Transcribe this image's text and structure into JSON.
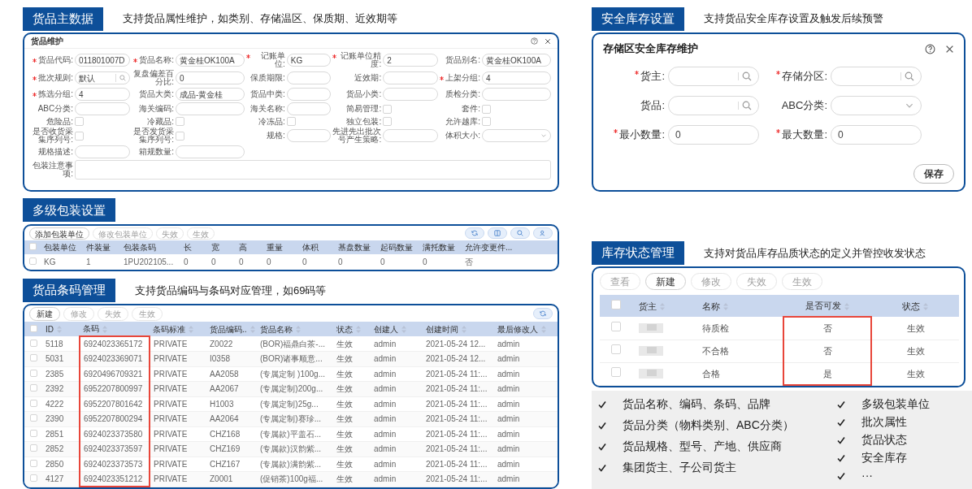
{
  "product_master": {
    "title": "货品主数据",
    "description": "支持货品属性维护，如类别、存储温区、保质期、近效期等",
    "form": {
      "title": "货品维护",
      "fields": [
        {
          "label": "货品代码:",
          "required": true,
          "kind": "text",
          "value": "011801007D"
        },
        {
          "label": "货品名称:",
          "required": true,
          "kind": "text",
          "value": "黄金桂OK100A"
        },
        {
          "label": "记账单位:",
          "required": true,
          "kind": "text",
          "value": "KG"
        },
        {
          "label": "记账单位精度:",
          "required": true,
          "kind": "text",
          "value": "2"
        },
        {
          "label": "货品别名:",
          "required": false,
          "kind": "text",
          "value": "黄金桂OK100A"
        },
        {
          "label": "批次规则:",
          "required": true,
          "kind": "search",
          "value": "默认"
        },
        {
          "label": "复盘偏差百分比:",
          "required": false,
          "kind": "text",
          "value": "0"
        },
        {
          "label": "保质期限:",
          "required": false,
          "kind": "text"
        },
        {
          "label": "近效期:",
          "required": false,
          "kind": "text"
        },
        {
          "label": "上架分组:",
          "required": true,
          "kind": "text",
          "value": "4"
        },
        {
          "label": "拣选分组:",
          "required": true,
          "kind": "text",
          "value": "4"
        },
        {
          "label": "货品大类:",
          "required": false,
          "kind": "text",
          "value": "成品-黄金桂"
        },
        {
          "label": "货品中类:",
          "required": false,
          "kind": "text"
        },
        {
          "label": "货品小类:",
          "required": false,
          "kind": "text"
        },
        {
          "label": "质检分类:",
          "required": false,
          "kind": "text"
        },
        {
          "label": "ABC分类:",
          "required": false,
          "kind": "text"
        },
        {
          "label": "海关编码:",
          "required": false,
          "kind": "text"
        },
        {
          "label": "海关名称:",
          "required": false,
          "kind": "text"
        },
        {
          "label": "简易管理:",
          "required": false,
          "kind": "checkbox",
          "checked": false
        },
        {
          "label": "套件:",
          "required": false,
          "kind": "checkbox",
          "checked": false
        },
        {
          "label": "危险品:",
          "required": false,
          "kind": "checkbox",
          "checked": false
        },
        {
          "label": "冷藏品:",
          "required": false,
          "kind": "checkbox",
          "checked": false
        },
        {
          "label": "冷冻品:",
          "required": false,
          "kind": "checkbox",
          "checked": false
        },
        {
          "label": "独立包装:",
          "required": false,
          "kind": "checkbox",
          "checked": false
        },
        {
          "label": "允许越库:",
          "required": false,
          "kind": "checkbox",
          "checked": false
        },
        {
          "label": "是否收货采集序列号:",
          "required": false,
          "kind": "checkbox",
          "checked": false
        },
        {
          "label": "是否发货采集序列号:",
          "required": false,
          "kind": "checkbox",
          "checked": false
        },
        {
          "label": "规格:",
          "required": false,
          "kind": "text"
        },
        {
          "label": "先进先出批次号产生策略:",
          "required": false,
          "kind": "text"
        },
        {
          "label": "体积大小:",
          "required": false,
          "kind": "select"
        },
        {
          "label": "规格描述:",
          "required": false,
          "kind": "text"
        },
        {
          "label": "箱规数量:",
          "required": false,
          "kind": "text"
        },
        {
          "label": "包装注意事项:",
          "required": false,
          "kind": "textarea"
        }
      ]
    }
  },
  "packaging": {
    "title": "多级包装设置",
    "buttons": [
      {
        "label": "添加包装单位",
        "disabled": false
      },
      {
        "label": "修改包装单位",
        "disabled": true
      },
      {
        "label": "失效",
        "disabled": true
      },
      {
        "label": "生效",
        "disabled": true
      }
    ],
    "table": {
      "all_checked": false,
      "columns": [
        "包装单位",
        "件装量",
        "包装条码",
        "长",
        "宽",
        "高",
        "重量",
        "体积",
        "基盘数量",
        "起码数量",
        "满托数量",
        "允许变更件..."
      ],
      "rows": [
        {
          "checked": false,
          "cells": [
            "KG",
            "1",
            "1PU202105...",
            "0",
            "0",
            "0",
            "0",
            "0",
            "0",
            "0",
            "0",
            "否"
          ]
        }
      ]
    }
  },
  "barcodes": {
    "title": "货品条码管理",
    "description": "支持货品编码与条码对应管理，如69码等",
    "buttons": [
      {
        "label": "新建",
        "disabled": false
      },
      {
        "label": "修改",
        "disabled": true
      },
      {
        "label": "失效",
        "disabled": true
      },
      {
        "label": "生效",
        "disabled": true
      }
    ],
    "table": {
      "all_checked": false,
      "columns": [
        "ID",
        "条码",
        "条码标准",
        "货品编码..",
        "货品名称",
        "状态",
        "创建人",
        "创建时间",
        "最后修改人"
      ],
      "rows": [
        {
          "checked": false,
          "cells": [
            "5118",
            "6924023365172",
            "PRIVATE",
            "Z0022",
            "(BOR)福鼎白茶-...",
            "生效",
            "admin",
            "2021-05-24 12...",
            "admin"
          ]
        },
        {
          "checked": false,
          "cells": [
            "5031",
            "6924023369071",
            "PRIVATE",
            "I0358",
            "(BOR)诸事顺意...",
            "生效",
            "admin",
            "2021-05-24 12...",
            "admin"
          ]
        },
        {
          "checked": false,
          "cells": [
            "2385",
            "6920496709321",
            "PRIVATE",
            "AA2058",
            "(专属定制 )100g...",
            "生效",
            "admin",
            "2021-05-24 11:...",
            "admin"
          ]
        },
        {
          "checked": false,
          "cells": [
            "2392",
            "6952207800997",
            "PRIVATE",
            "AA2067",
            "(专属定制)200g...",
            "生效",
            "admin",
            "2021-05-24 11:...",
            "admin"
          ]
        },
        {
          "checked": false,
          "cells": [
            "4222",
            "6952207801642",
            "PRIVATE",
            "H1003",
            "(专属定制)25g...",
            "生效",
            "admin",
            "2021-05-24 11:...",
            "admin"
          ]
        },
        {
          "checked": false,
          "cells": [
            "2390",
            "6952207800294",
            "PRIVATE",
            "AA2064",
            "(专属定制)赛珍...",
            "生效",
            "admin",
            "2021-05-24 11:...",
            "admin"
          ]
        },
        {
          "checked": false,
          "cells": [
            "2851",
            "6924023373580",
            "PRIVATE",
            "CHZ168",
            "(专属款)平盖石...",
            "生效",
            "admin",
            "2021-05-24 11:...",
            "admin"
          ]
        },
        {
          "checked": false,
          "cells": [
            "2852",
            "6924023373597",
            "PRIVATE",
            "CHZ169",
            "(专属款)汉韵紫...",
            "生效",
            "admin",
            "2021-05-24 11:...",
            "admin"
          ]
        },
        {
          "checked": false,
          "cells": [
            "2850",
            "6924023373573",
            "PRIVATE",
            "CHZ167",
            "(专属款)满韵紫...",
            "生效",
            "admin",
            "2021-05-24 11:...",
            "admin"
          ]
        },
        {
          "checked": false,
          "cells": [
            "4127",
            "6924023351212",
            "PRIVATE",
            "Z0001",
            "(促销茶)100g福...",
            "生效",
            "admin",
            "2021-05-24 11:...",
            "admin"
          ]
        }
      ]
    }
  },
  "safety_stock": {
    "title": "安全库存设置",
    "description": "支持货品安全库存设置及触发后续预警",
    "dialog": {
      "title": "存储区安全库存维护",
      "fields": [
        {
          "label": "货主:",
          "required": true,
          "kind": "search"
        },
        {
          "label": "存储分区:",
          "required": true,
          "kind": "search"
        },
        {
          "label": "货品:",
          "required": false,
          "kind": "search"
        },
        {
          "label": "ABC分类:",
          "required": false,
          "kind": "select"
        },
        {
          "label": "最小数量:",
          "required": true,
          "kind": "text",
          "value": "0"
        },
        {
          "label": "最大数量:",
          "required": true,
          "kind": "text",
          "value": "0"
        }
      ],
      "save_button": "保存"
    }
  },
  "stock_status": {
    "title": "库存状态管理",
    "description": "支持对货品库存品质状态的定义并管控收发状态",
    "buttons": [
      {
        "label": "查看",
        "disabled": true
      },
      {
        "label": "新建",
        "disabled": false
      },
      {
        "label": "修改",
        "disabled": true
      },
      {
        "label": "失效",
        "disabled": true
      },
      {
        "label": "生效",
        "disabled": true
      }
    ],
    "table": {
      "all_checked": false,
      "columns": [
        "货主",
        "名称",
        "是否可发",
        "状态"
      ],
      "rows": [
        {
          "checked": false,
          "name": "待质检",
          "shippable": "否",
          "status": "生效"
        },
        {
          "checked": false,
          "name": "不合格",
          "shippable": "否",
          "status": "生效"
        },
        {
          "checked": false,
          "name": "合格",
          "shippable": "是",
          "status": "生效"
        }
      ]
    }
  },
  "features": {
    "left": [
      "货品名称、编码、条码、品牌",
      "货品分类（物料类别、ABC分类）",
      "货品规格、型号、产地、供应商",
      "集团货主、子公司货主"
    ],
    "right": [
      "多级包装单位",
      "批次属性",
      "货品状态",
      "安全库存",
      "···"
    ]
  }
}
